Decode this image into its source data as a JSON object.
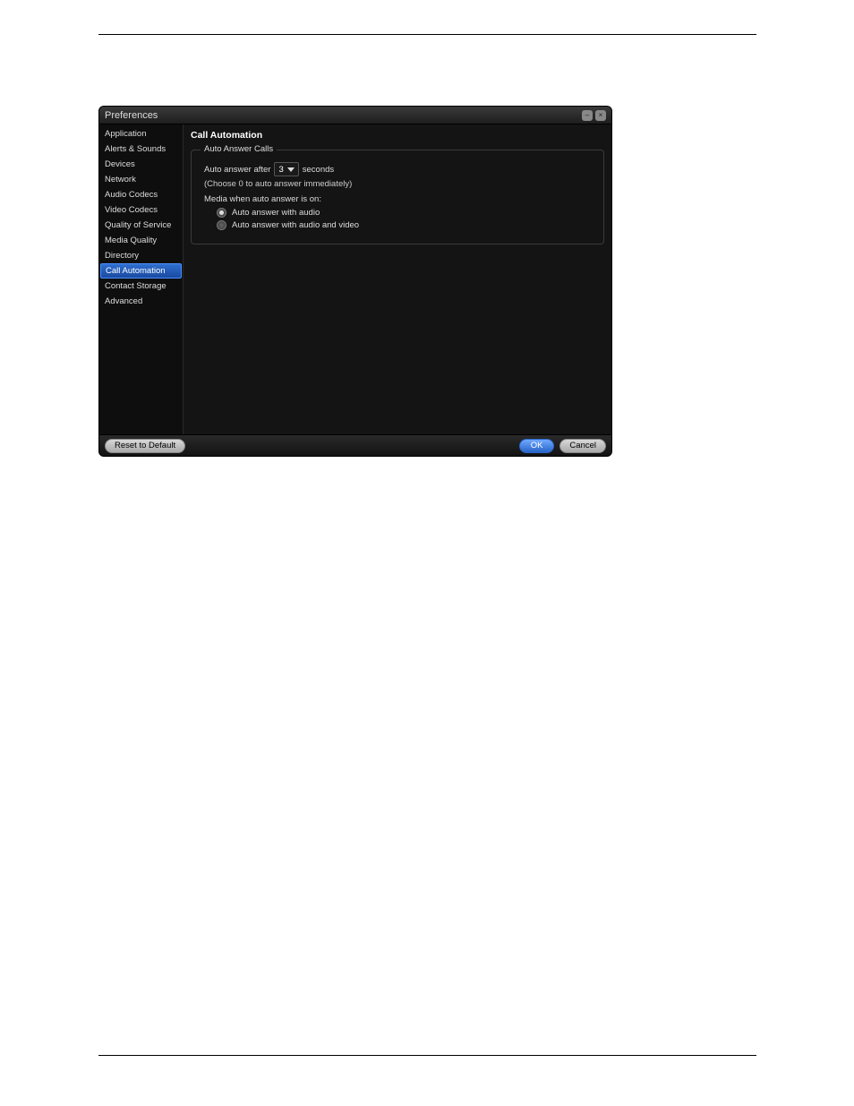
{
  "window": {
    "title": "Preferences"
  },
  "sidebar": {
    "items": [
      {
        "label": "Application"
      },
      {
        "label": "Alerts & Sounds"
      },
      {
        "label": "Devices"
      },
      {
        "label": "Network"
      },
      {
        "label": "Audio Codecs"
      },
      {
        "label": "Video Codecs"
      },
      {
        "label": "Quality of Service"
      },
      {
        "label": "Media Quality"
      },
      {
        "label": "Directory"
      },
      {
        "label": "Call Automation"
      },
      {
        "label": "Contact Storage"
      },
      {
        "label": "Advanced"
      }
    ],
    "selectedIndex": 9
  },
  "content": {
    "title": "Call Automation",
    "group_legend": "Auto Answer Calls",
    "auto_answer_prefix": "Auto answer after",
    "auto_answer_value": "3",
    "auto_answer_suffix": "seconds",
    "immediate_note": "(Choose 0 to auto answer immediately)",
    "media_heading": "Media when auto answer is on:",
    "radio_audio": "Auto answer with audio",
    "radio_av": "Auto answer with audio and video",
    "selected_radio": "audio"
  },
  "footer": {
    "reset": "Reset to Default",
    "ok": "OK",
    "cancel": "Cancel"
  }
}
